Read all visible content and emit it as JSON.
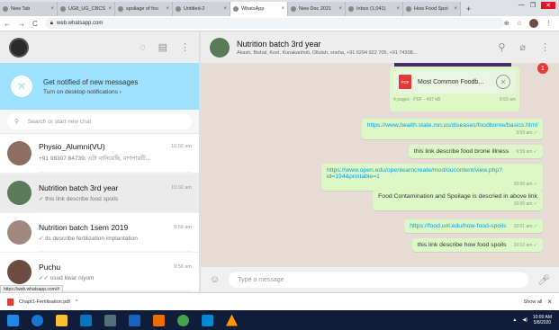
{
  "browser": {
    "tabs": [
      {
        "label": "New Tab",
        "active": false
      },
      {
        "label": "UG8_UG_CBCS",
        "active": false
      },
      {
        "label": "spoilage of foo",
        "active": false
      },
      {
        "label": "Untitled-2",
        "active": false
      },
      {
        "label": "WhatsApp",
        "active": true
      },
      {
        "label": "New Doc 2021",
        "active": false
      },
      {
        "label": "Inbox (1,041)",
        "active": false
      },
      {
        "label": "How Food Spoi",
        "active": false
      }
    ],
    "new_tab": "+",
    "url": "web.whatsapp.com",
    "colors": {
      "active_tab": "#ffffff",
      "tab_bar": "#dee1e6"
    }
  },
  "sidebar": {
    "notification": {
      "title": "Get notified of new messages",
      "action": "Turn on desktop notifications ›"
    },
    "search_placeholder": "Search or start new chat",
    "chats": [
      {
        "name": "Physio_Alumni(VU)",
        "time": "10:02 am",
        "preview": "+91 98307 84739: এটা বানিয়েছি, বাগপারটি...",
        "selected": false,
        "avatar_color": "#8d6e63"
      },
      {
        "name": "Nutrition batch 3rd year",
        "time": "10:02 am",
        "preview": "✓ this link describe food spoils",
        "selected": true,
        "avatar_color": "#5a7a5a"
      },
      {
        "name": "Nutrition batch 1sem 2019",
        "time": "9:58 am",
        "preview": "✓ its describe fertilization implantation",
        "selected": false,
        "avatar_color": "#a1887f"
      },
      {
        "name": "Puchu",
        "time": "9:56 am",
        "preview": "✓✓ osud kwar niyom",
        "selected": false,
        "avatar_color": "#6d4c41"
      }
    ],
    "status_url": "https://web.whatsapp.com/#"
  },
  "conversation": {
    "group_name": "Nutrition batch 3rd year",
    "members": "Akash, Bishal, Koel, Konakanholi, Ollulah, sneha, +91 6294 922 705, +91 74308...",
    "unread_badge": "1",
    "file": {
      "name": "Most Common Foodb...",
      "icon_label": "PDF",
      "meta": "4 pages · PDF · 407 kB",
      "time": "9:53 am"
    },
    "messages": [
      {
        "text": "https://www.health.state.mn.us/diseases/foodborne/basics.html",
        "time": "9:59 am ✓",
        "link": true
      },
      {
        "text": "this link describe food brone illness",
        "time": "9:59 am ✓",
        "link": false
      },
      {
        "text": "https://www.open.edu/openlearncreate/mod/oucontent/view.php?id=194&printable=1",
        "time": "10:00 am ✓",
        "link": true
      },
      {
        "text": "Food Contamination and Spoilage is descried in above link",
        "time": "10:00 am ✓",
        "link": false
      },
      {
        "text": "https://food.unl.edu/how-food-spoils",
        "time": "10:01 am ✓",
        "link": true
      },
      {
        "text": "this link describe how food spoils",
        "time": "10:02 am ✓",
        "link": false
      }
    ],
    "composer_placeholder": "Type a message",
    "colors": {
      "bubble": "#dcf8c6",
      "background": "#e5ddd5",
      "link": "#039be5"
    }
  },
  "downloads": {
    "file": "Chapt1-Fertilisation.pdf",
    "show_all": "Show all",
    "close": "×"
  },
  "taskbar": {
    "time": "10:00 AM",
    "date": "5/8/2020",
    "icons": [
      "windows-icon",
      "edge-icon",
      "file-explorer-icon",
      "office-icon",
      "calculator-icon",
      "mail-icon",
      "app-icon",
      "chrome-icon",
      "app2-icon",
      "vlc-icon"
    ]
  }
}
